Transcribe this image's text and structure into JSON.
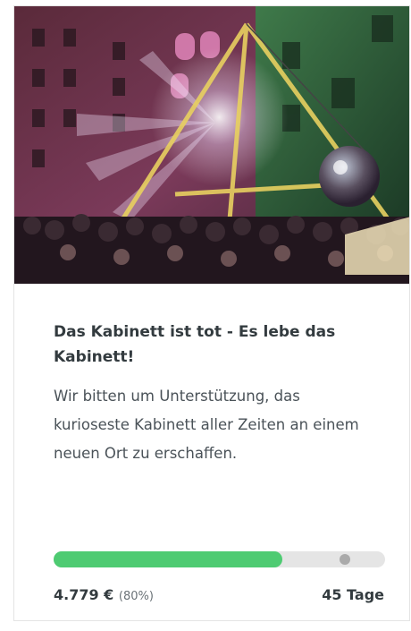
{
  "card": {
    "image_alt": "Crowd at night in courtyard with illuminated stage truss and disco ball",
    "title": "Das Kabinett ist tot - Es lebe das Kabinett!",
    "description": "Wir bitten um Unterstützung, das kurioseste Kabinett aller Zeiten an einem neuen Ort zu erschaffen.",
    "amount": "4.779 €",
    "percent_text": "(80%)",
    "progress_fraction": 0.69,
    "marker_fraction": 0.88,
    "days_left": "45 Tage"
  },
  "colors": {
    "progress_fill": "#4ecb72",
    "progress_track": "#e5e5e5",
    "marker": "#aaaaaa",
    "text_dark": "#333b3f"
  }
}
